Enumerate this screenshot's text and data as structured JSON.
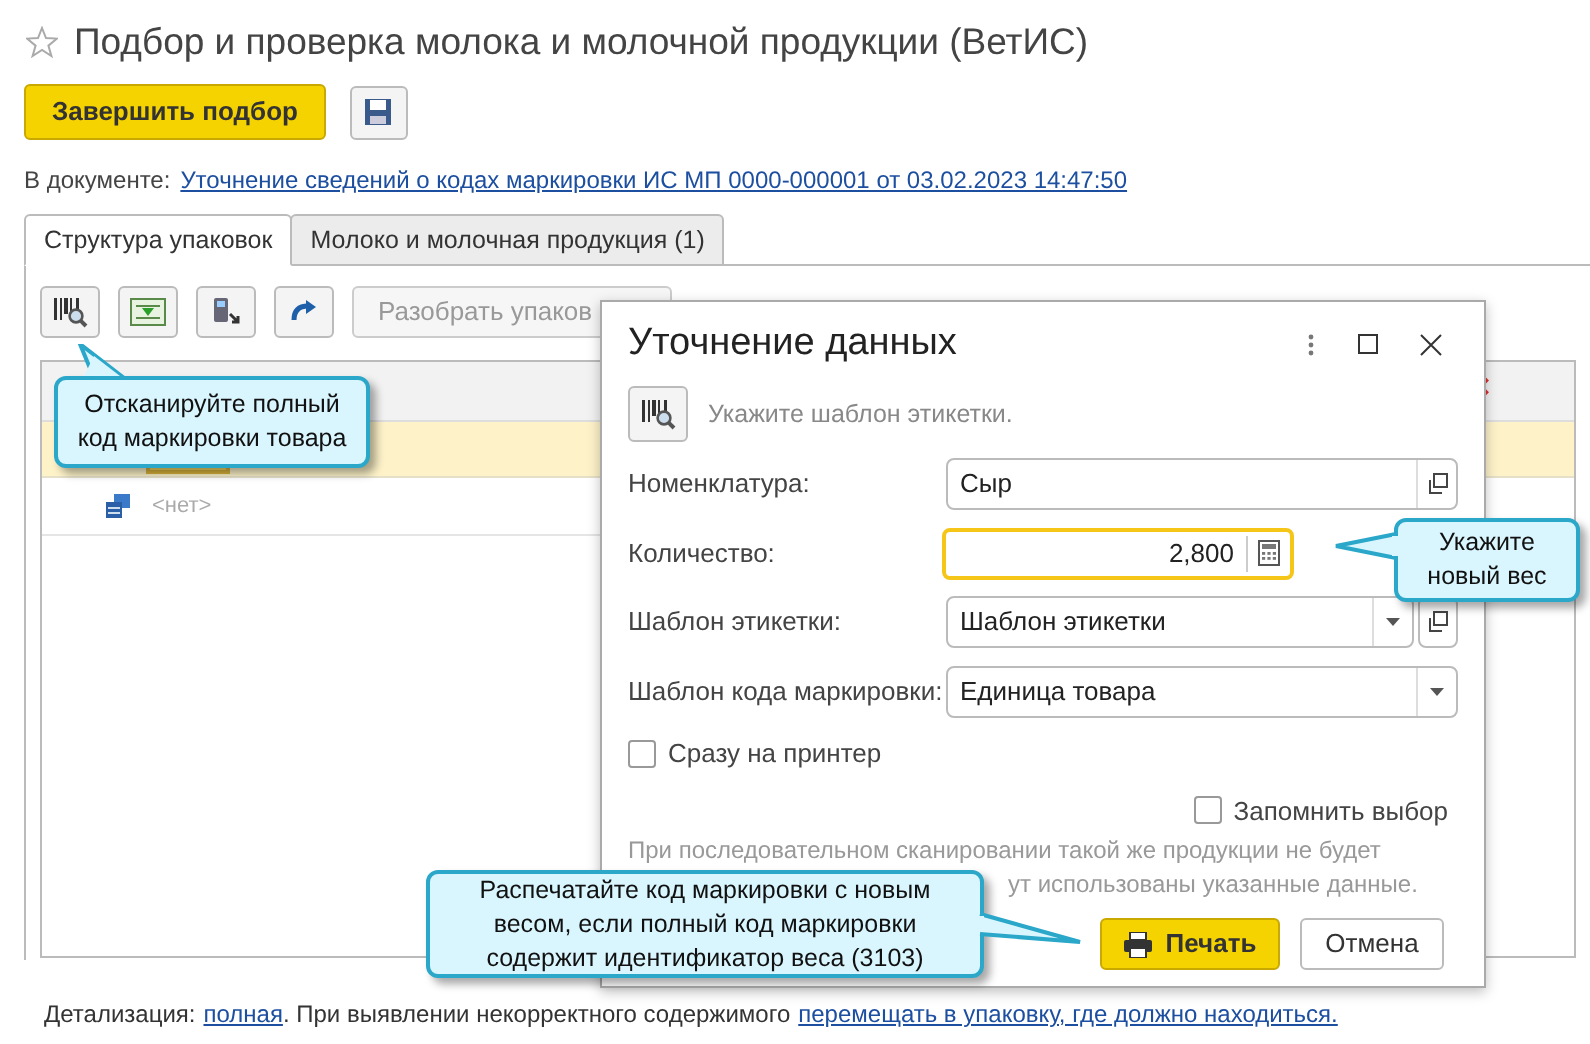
{
  "window": {
    "title": "Подбор и проверка молока и молочной продукции (ВетИС)"
  },
  "toolbar": {
    "finish_button": "Завершить подбор"
  },
  "document": {
    "label": "В документе:",
    "link": "Уточнение сведений о кодах маркировки ИС МП 0000-000001 от 03.02.2023 14:47:50"
  },
  "tabs": [
    {
      "label": "Структура упаковок",
      "selected": true
    },
    {
      "label": "Молоко и молочная продукция (1)",
      "selected": false
    }
  ],
  "panel_toolbar": {
    "disassemble_button": "Разобрать упаков"
  },
  "table": {
    "rows": [
      {
        "kind": "selected",
        "text": ""
      },
      {
        "kind": "package",
        "text": "<нет>"
      }
    ]
  },
  "footer": {
    "label": "Детализация:",
    "detail_link": "полная",
    "middle": ". При выявлении некорректного содержимого",
    "move_link": "перемещать в упаковку, где должно находиться."
  },
  "dialog": {
    "title": "Уточнение данных",
    "scan_hint": "Укажите шаблон этикетки.",
    "fields": [
      {
        "label": "Номенклатура:",
        "value": "Сыр",
        "kind": "open",
        "focused": false
      },
      {
        "label": "Количество:",
        "value": "2,800",
        "kind": "number",
        "focused": true
      },
      {
        "label": "Шаблон этикетки:",
        "value": "Шаблон этикетки",
        "kind": "select_open",
        "focused": false
      },
      {
        "label": "Шаблон кода маркировки:",
        "value": "Единица товара",
        "kind": "select",
        "focused": false
      }
    ],
    "print_now": {
      "label": "Сразу на принтер",
      "checked": false
    },
    "remember": {
      "label": "Запомнить выбор",
      "checked": false
    },
    "hint_line1": "При последовательном сканировании такой же продукции не будет",
    "hint_line2": "ут использованы указанные данные.",
    "buttons": [
      {
        "label": "Печать",
        "kind": "primary"
      },
      {
        "label": "Отмена",
        "kind": "default"
      }
    ]
  },
  "callouts": [
    {
      "text": "Отсканируйте полный код маркировки товара",
      "kind": "scan"
    },
    {
      "text": "Укажите новый вес",
      "kind": "weight"
    },
    {
      "text": "Распечатайте код маркировки с новым весом, если полный код маркировки содержит идентификатор веса (3103)",
      "kind": "print"
    }
  ]
}
